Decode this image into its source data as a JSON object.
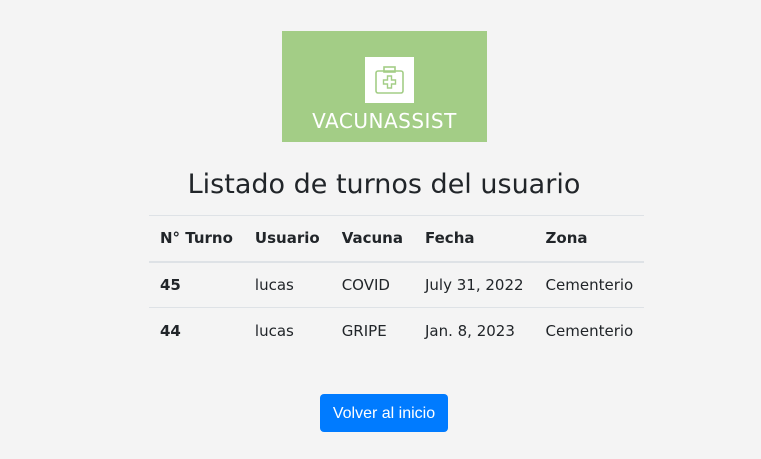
{
  "logo": {
    "text": "VACUNASSIST",
    "icon": "first-aid-kit-icon",
    "background_color": "#a3cd86"
  },
  "page": {
    "title": "Listado de turnos del usuario"
  },
  "table": {
    "headers": [
      "N° Turno",
      "Usuario",
      "Vacuna",
      "Fecha",
      "Zona"
    ],
    "rows": [
      [
        "45",
        "lucas",
        "COVID",
        "July 31, 2022",
        "Cementerio"
      ],
      [
        "44",
        "lucas",
        "GRIPE",
        "Jan. 8, 2023",
        "Cementerio"
      ]
    ]
  },
  "actions": {
    "back_label": "Volver al inicio",
    "button_color": "#007bff"
  }
}
